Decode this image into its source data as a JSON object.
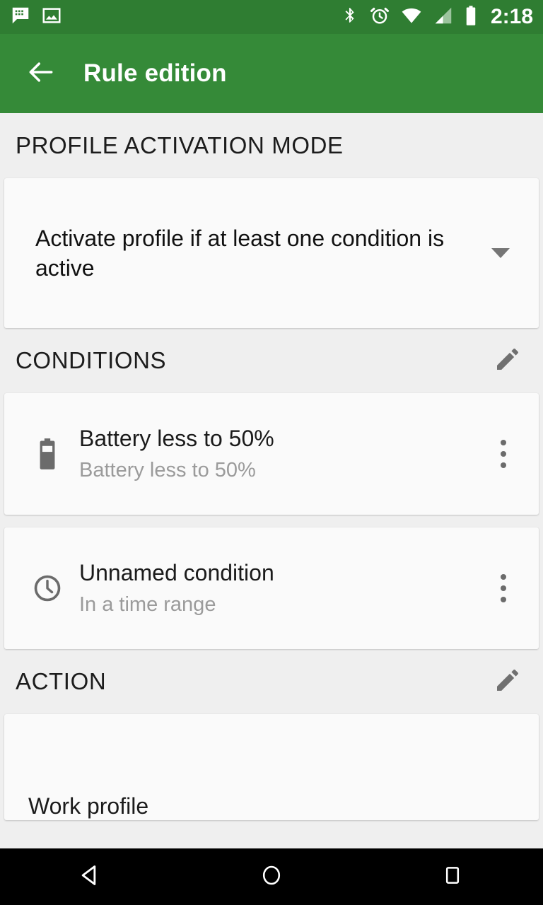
{
  "status_bar": {
    "background_color": "#2f7d32",
    "time": "2:18",
    "left_icons": [
      {
        "name": "messaging-icon",
        "label": "messaging"
      },
      {
        "name": "image-icon",
        "label": "screenshot"
      }
    ],
    "right_icons": [
      {
        "name": "bluetooth-icon",
        "label": "bluetooth"
      },
      {
        "name": "alarm-icon",
        "label": "alarm"
      },
      {
        "name": "wifi-icon",
        "label": "wifi"
      },
      {
        "name": "cellular-signal-icon",
        "label": "cellular"
      },
      {
        "name": "battery-icon",
        "label": "battery"
      }
    ]
  },
  "app_bar": {
    "background_color": "#358a38",
    "title": "Rule edition",
    "back_icon": "arrow-back-icon"
  },
  "sections": {
    "activation_mode": {
      "header": "PROFILE ACTIVATION MODE",
      "spinner_value": "Activate profile if at least one condition is active",
      "spinner_icon": "chevron-down-icon"
    },
    "conditions": {
      "header": "CONDITIONS",
      "edit_icon": "pencil-icon",
      "items": [
        {
          "icon": "battery-icon",
          "title": "Battery less to 50%",
          "subtitle": "Battery less to 50%",
          "menu_icon": "more-vert-icon"
        },
        {
          "icon": "clock-icon",
          "title": "Unnamed condition",
          "subtitle": "In a time range",
          "menu_icon": "more-vert-icon"
        }
      ]
    },
    "action": {
      "header": "ACTION",
      "edit_icon": "pencil-icon",
      "item": {
        "title": "Work profile"
      }
    }
  },
  "nav_bar": {
    "background_color": "#000000",
    "buttons": [
      {
        "name": "nav-back-button",
        "label": "Back"
      },
      {
        "name": "nav-home-button",
        "label": "Home"
      },
      {
        "name": "nav-recents-button",
        "label": "Recents"
      }
    ]
  },
  "colors": {
    "status_bar": "#2f7d32",
    "app_bar": "#358a38",
    "page_background": "#efefef",
    "card_background": "#fafafa",
    "primary_text": "#1b1b1b",
    "secondary_text": "#9b9b9b"
  }
}
